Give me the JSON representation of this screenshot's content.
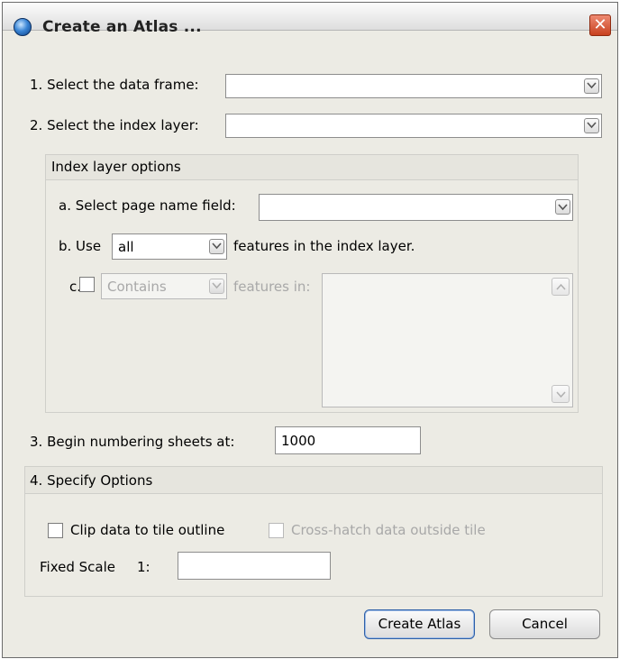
{
  "window": {
    "title": "Create an Atlas ..."
  },
  "fields": {
    "data_frame": {
      "label": "1. Select the data frame:",
      "value": ""
    },
    "index_layer": {
      "label": "2. Select the index layer:",
      "value": ""
    }
  },
  "index_layer_options": {
    "header": "Index layer options",
    "page_name_field": {
      "label": "a. Select page name field:",
      "value": ""
    },
    "use": {
      "prefix": "b. Use",
      "value": "all",
      "suffix": "features in the index layer."
    },
    "spatial": {
      "prefix": "c.",
      "value": "Contains",
      "suffix": "features in:",
      "checked": false
    }
  },
  "numbering": {
    "label": "3. Begin numbering sheets at:",
    "value": "1000"
  },
  "options": {
    "header": "4. Specify Options",
    "clip_label": "Clip data to tile outline",
    "crosshatch_label": "Cross-hatch data outside tile",
    "fixed_scale_label": "Fixed Scale",
    "scale_prefix": "1:",
    "scale_value": ""
  },
  "buttons": {
    "create": "Create Atlas",
    "cancel": "Cancel"
  },
  "icons": {
    "app": "globe-icon",
    "close": "close-icon",
    "dropdown": "chevron-down-icon",
    "scroll_up": "chevron-up-icon"
  },
  "colors": {
    "close_button": "#d2502c",
    "dialog_bg": "#ecebe4"
  }
}
